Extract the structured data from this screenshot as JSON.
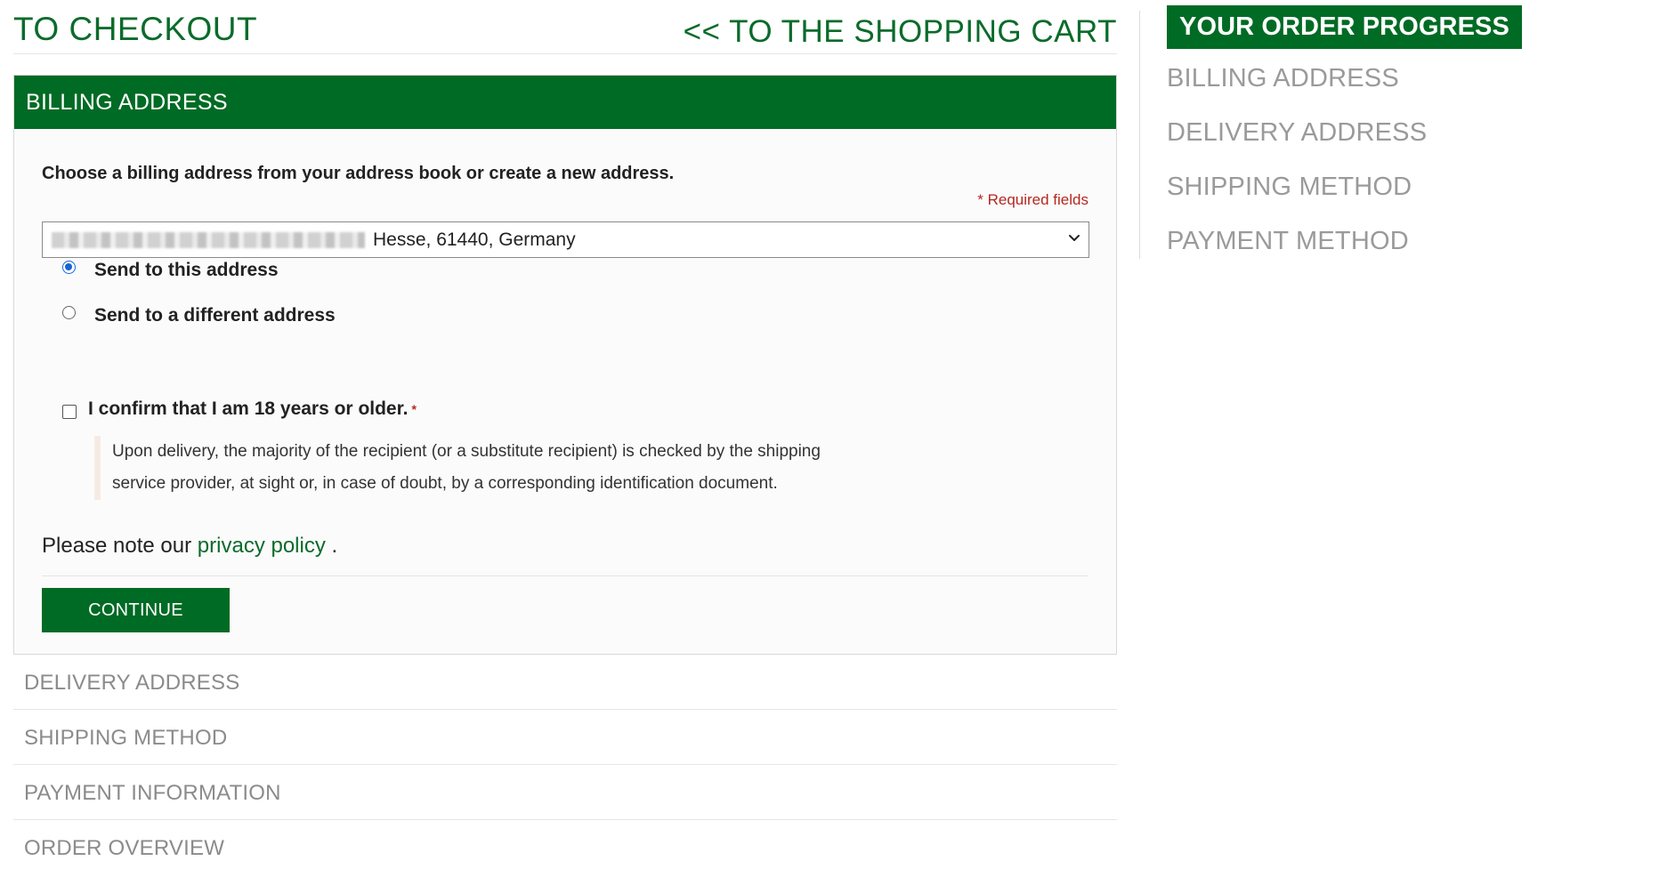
{
  "header": {
    "title": "TO CHECKOUT",
    "back_link": "<< TO THE SHOPPING CART"
  },
  "billing": {
    "section_title": "BILLING ADDRESS",
    "intro": "Choose a billing address from your address book or create a new address.",
    "required_note": "* Required fields",
    "address_select": {
      "selected_value": "Hesse, 61440, Germany"
    },
    "radios": [
      {
        "label": "Send to this address",
        "checked": true
      },
      {
        "label": "Send to a different address",
        "checked": false
      }
    ],
    "age_confirm": {
      "label": "I confirm that I am 18 years or older.",
      "required_mark": "*",
      "checked": false,
      "note": "Upon delivery, the majority of the recipient (or a substitute recipient) is checked by the shipping service provider, at sight or, in case of doubt, by a corresponding identification document."
    },
    "privacy": {
      "prefix": "Please note our",
      "link": "privacy policy",
      "suffix": "."
    },
    "continue_label": "CONTINUE"
  },
  "steps": [
    "DELIVERY ADDRESS",
    "SHIPPING METHOD",
    "PAYMENT INFORMATION",
    "ORDER OVERVIEW"
  ],
  "sidebar": {
    "title": "YOUR ORDER PROGRESS",
    "items": [
      "BILLING ADDRESS",
      "DELIVERY ADDRESS",
      "SHIPPING METHOD",
      "PAYMENT METHOD"
    ]
  },
  "colors": {
    "brand_green": "#006b24",
    "link_green": "#0b6b2b",
    "required_red": "#b5281f",
    "muted_gray": "#8b8b8b"
  },
  "icons": {
    "select_arrow": "chevron-down-icon"
  }
}
